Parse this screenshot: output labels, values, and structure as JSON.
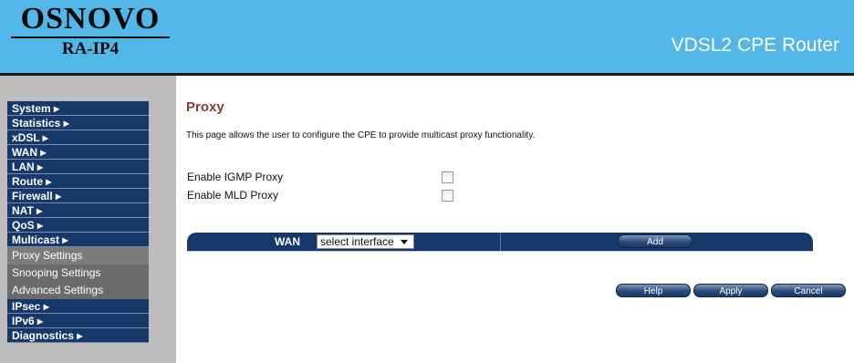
{
  "brand": {
    "logo_text": "OSNOVO",
    "model": "RA-IP4",
    "product_title": "VDSL2 CPE Router"
  },
  "colors": {
    "header_bg": "#52b6e8",
    "nav_bg": "#17386a",
    "submenu_bg": "#6b6b6b",
    "sidebar_bg": "#bdbdbd",
    "title_color": "#8a3b32"
  },
  "sidebar": {
    "items": [
      {
        "label": "System ▸"
      },
      {
        "label": "Statistics ▸"
      },
      {
        "label": "xDSL ▸"
      },
      {
        "label": "WAN ▸"
      },
      {
        "label": "LAN ▸"
      },
      {
        "label": "Route ▸"
      },
      {
        "label": "Firewall ▸"
      },
      {
        "label": "NAT ▸"
      },
      {
        "label": "QoS ▸"
      },
      {
        "label": "Multicast ▸"
      }
    ],
    "multicast_submenu": [
      {
        "label": "Proxy Settings",
        "active": true
      },
      {
        "label": "Snooping Settings"
      },
      {
        "label": "Advanced Settings"
      }
    ],
    "items_after": [
      {
        "label": "IPsec ▸"
      },
      {
        "label": "IPv6 ▸"
      },
      {
        "label": "Diagnostics ▸"
      }
    ]
  },
  "main": {
    "title": "Proxy",
    "description": "This page allows the user to configure the CPE to provide multicast proxy functionality.",
    "options": [
      {
        "label": "Enable IGMP Proxy",
        "checked": false
      },
      {
        "label": "Enable MLD Proxy",
        "checked": false
      }
    ],
    "wan": {
      "label": "WAN",
      "select_value": "select interface",
      "add_label": "Add"
    },
    "buttons": {
      "help": "Help",
      "apply": "Apply",
      "cancel": "Cancel"
    }
  }
}
